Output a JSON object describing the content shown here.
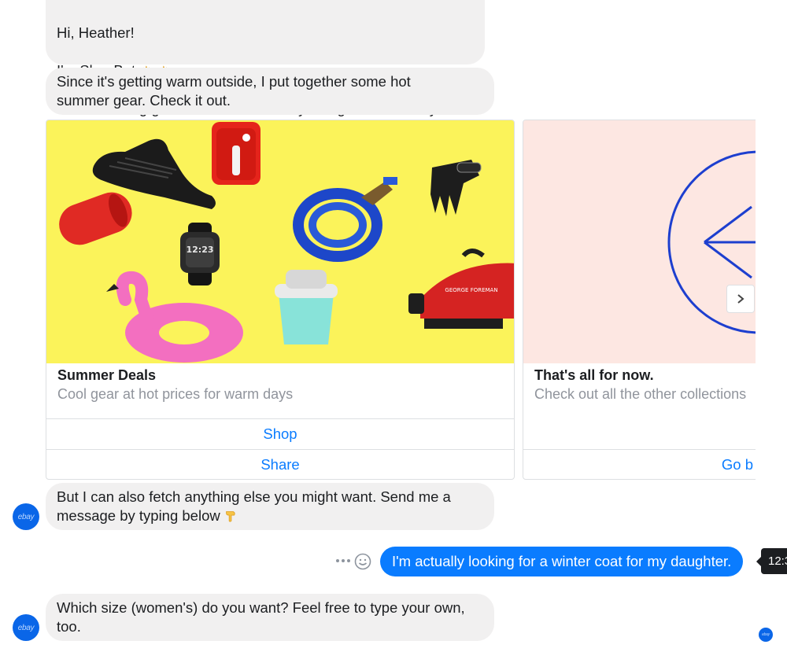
{
  "messages": {
    "greeting": "Hi, Heather!\nI'm ShopBot 👋 👋\nI make finding great deals effortless by doing the work for you.",
    "greeting_line1": "Hi, Heather!",
    "greeting_line2": "I'm ShopBot",
    "greeting_line3": "I make finding great deals effortless by doing the work for you.",
    "summer_intro": "Since it's getting warm outside, I put together some hot\nsummer gear. Check it out.",
    "fetch_text": "But I can also fetch anything else you might want. Send me a\nmessage by typing below",
    "user_message": "I'm actually looking for a winter coat for my daughter.",
    "size_question": "Which size (women's) do you want? Feel free to type your own,\ntoo.",
    "timestamp": "12:3"
  },
  "cards": [
    {
      "title": "Summer Deals",
      "subtitle": "Cool gear at hot prices for warm days",
      "buttons": [
        "Shop",
        "Share"
      ],
      "image_bg": "#fbf35a",
      "product_labels": {
        "watch_time": "12:23",
        "grill_brand": "GEORGE FOREMAN"
      }
    },
    {
      "title": "That's all for now.",
      "subtitle": "Check out all the other collections",
      "buttons": [
        "Go back"
      ],
      "button_visible": "Go b",
      "image_bg": "#fde7e2"
    }
  ],
  "avatar": {
    "label": "ebay",
    "color": "#0a66e8"
  },
  "colors": {
    "accent": "#0a7cff",
    "bubble": "#f1f0f0",
    "border": "#dddfe2"
  },
  "icons": [
    "wave-emoji-icon",
    "pointing-down-emoji-icon",
    "more-dots-icon",
    "smiley-icon",
    "chevron-right-icon",
    "arrow-left-icon"
  ]
}
